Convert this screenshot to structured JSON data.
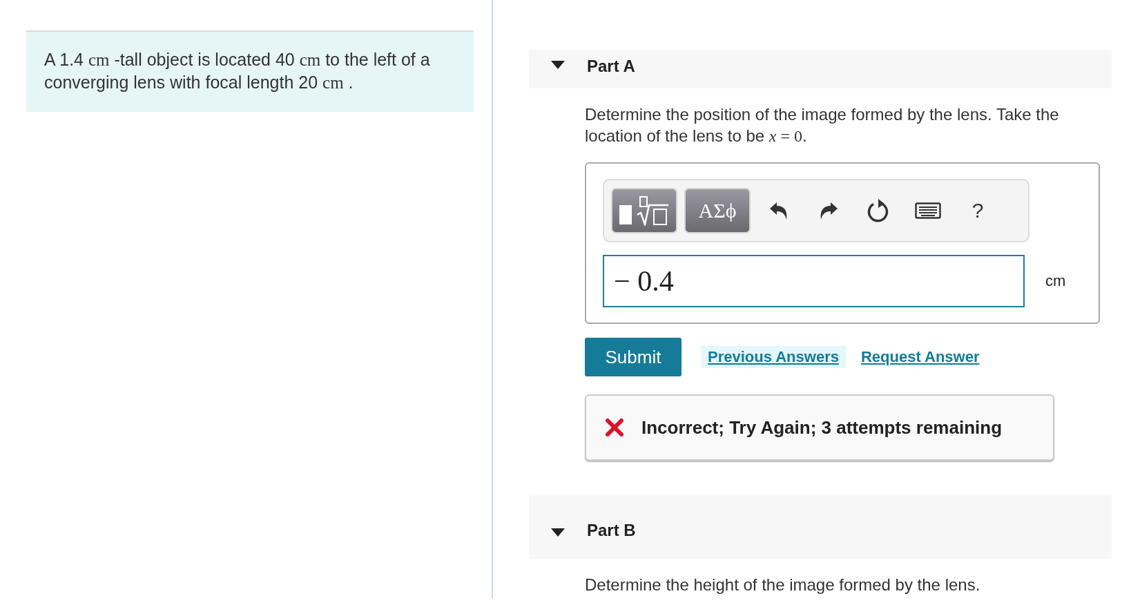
{
  "problem": {
    "segments": [
      {
        "kind": "text",
        "text": "A 1.4 "
      },
      {
        "kind": "unit",
        "text": "cm"
      },
      {
        "kind": "text",
        "text": " -tall object is located 40 "
      },
      {
        "kind": "unit",
        "text": "cm"
      },
      {
        "kind": "text",
        "text": " to the left of a converging lens with focal length 20 "
      },
      {
        "kind": "unit",
        "text": "cm"
      },
      {
        "kind": "text",
        "text": " ."
      }
    ]
  },
  "parts": [
    {
      "title": "Part A",
      "expanded": true,
      "prompt": [
        {
          "kind": "text",
          "text": "Determine the position of the image formed by the lens.  Take the location of the lens to be "
        },
        {
          "kind": "var",
          "text": "x"
        },
        {
          "kind": "unit",
          "text": " = 0"
        },
        {
          "kind": "text",
          "text": "."
        }
      ],
      "answer": {
        "toolbar": [
          {
            "kind": "templates"
          },
          {
            "kind": "greek",
            "label": "ΑΣϕ"
          },
          {
            "kind": "undo"
          },
          {
            "kind": "redo"
          },
          {
            "kind": "reset"
          },
          {
            "kind": "keyboard"
          },
          {
            "kind": "help",
            "label": "?"
          }
        ],
        "value": "− 0.4",
        "unit": "cm"
      },
      "submit": "Submit",
      "links": [
        {
          "label": "Previous Answers",
          "highlighted": true
        },
        {
          "label": "Request Answer",
          "highlighted": false
        }
      ],
      "feedback": {
        "correct": false,
        "text": "Incorrect; Try Again; 3 attempts remaining"
      }
    },
    {
      "title": "Part B",
      "expanded": true,
      "prompt": [
        {
          "kind": "text",
          "text": "Determine the height of the image formed by the lens."
        }
      ]
    }
  ]
}
